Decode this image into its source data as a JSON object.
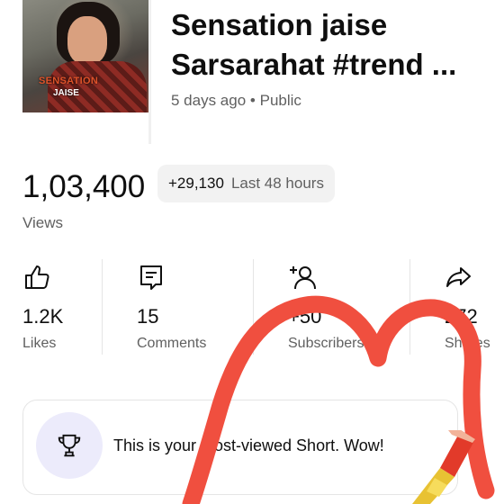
{
  "video": {
    "title_line1": "Sensation jaise",
    "title_line2": "Sarsarahat #trend ...",
    "age": "5 days ago",
    "separator": "•",
    "visibility": "Public",
    "thumbnail_caption_top": "SENSATION",
    "thumbnail_caption_bottom": "JAISE"
  },
  "views": {
    "count": "1,03,400",
    "delta": "+29,130",
    "period": "Last 48 hours",
    "label": "Views"
  },
  "stats": [
    {
      "icon": "thumbs-up-icon",
      "value": "1.2K",
      "label": "Likes"
    },
    {
      "icon": "comment-icon",
      "value": "15",
      "label": "Comments"
    },
    {
      "icon": "add-person-icon",
      "value": "+50",
      "label": "Subscribers"
    },
    {
      "icon": "share-icon",
      "value": "272",
      "label": "Shares"
    }
  ],
  "banner": {
    "icon": "trophy-icon",
    "message": "This is your most-viewed Short. Wow!"
  },
  "overlay": {
    "shape": "heart-doodle",
    "color": "#f04f3f",
    "tool": "lipstick-icon"
  }
}
